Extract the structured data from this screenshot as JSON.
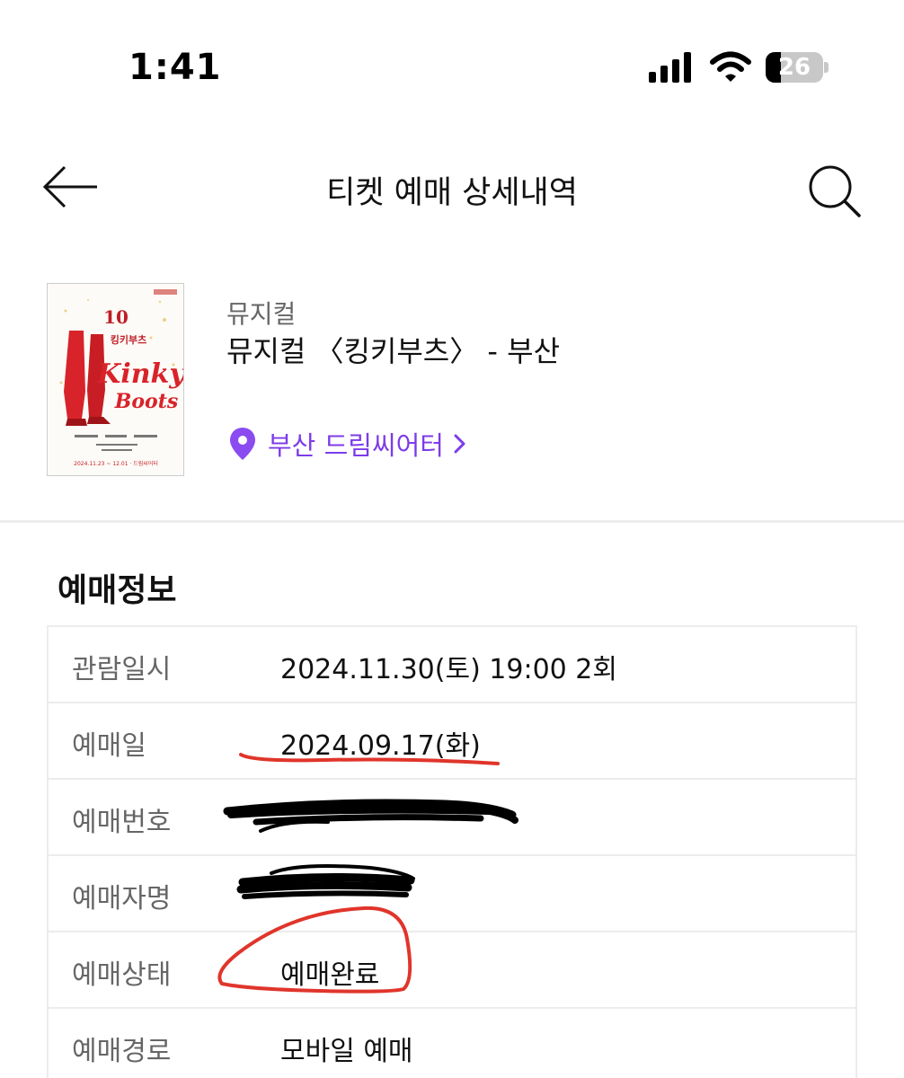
{
  "status_bar": {
    "time": "1:41",
    "battery_level": "26",
    "battery_fraction": 0.26
  },
  "nav": {
    "title": "티켓 예매 상세내역",
    "back_icon": "arrow-left-icon",
    "search_icon": "search-icon"
  },
  "show": {
    "genre": "뮤지컬",
    "title": "뮤지컬 〈킹키부츠〉 - 부산",
    "venue": "부산 드림씨어터",
    "poster": {
      "number": "10",
      "korean_title": "킹키부츠",
      "logo_line1": "Kinky",
      "logo_line2": "Boots",
      "dates": "2024.11.23 ~ 12.01 · 드림씨어터"
    }
  },
  "booking": {
    "section_title": "예매정보",
    "rows": [
      {
        "label": "관람일시",
        "value": "2024.11.30(토) 19:00 2회"
      },
      {
        "label": "예매일",
        "value": "2024.09.17(화)"
      },
      {
        "label": "예매번호",
        "value": ""
      },
      {
        "label": "예매자명",
        "value": ""
      },
      {
        "label": "예매상태",
        "value": "예매완료"
      },
      {
        "label": "예매경로",
        "value": "모바일 예매"
      }
    ]
  },
  "colors": {
    "accent": "#7d3ce8",
    "annotation_red": "#e0352b",
    "poster_red": "#d8232a"
  }
}
